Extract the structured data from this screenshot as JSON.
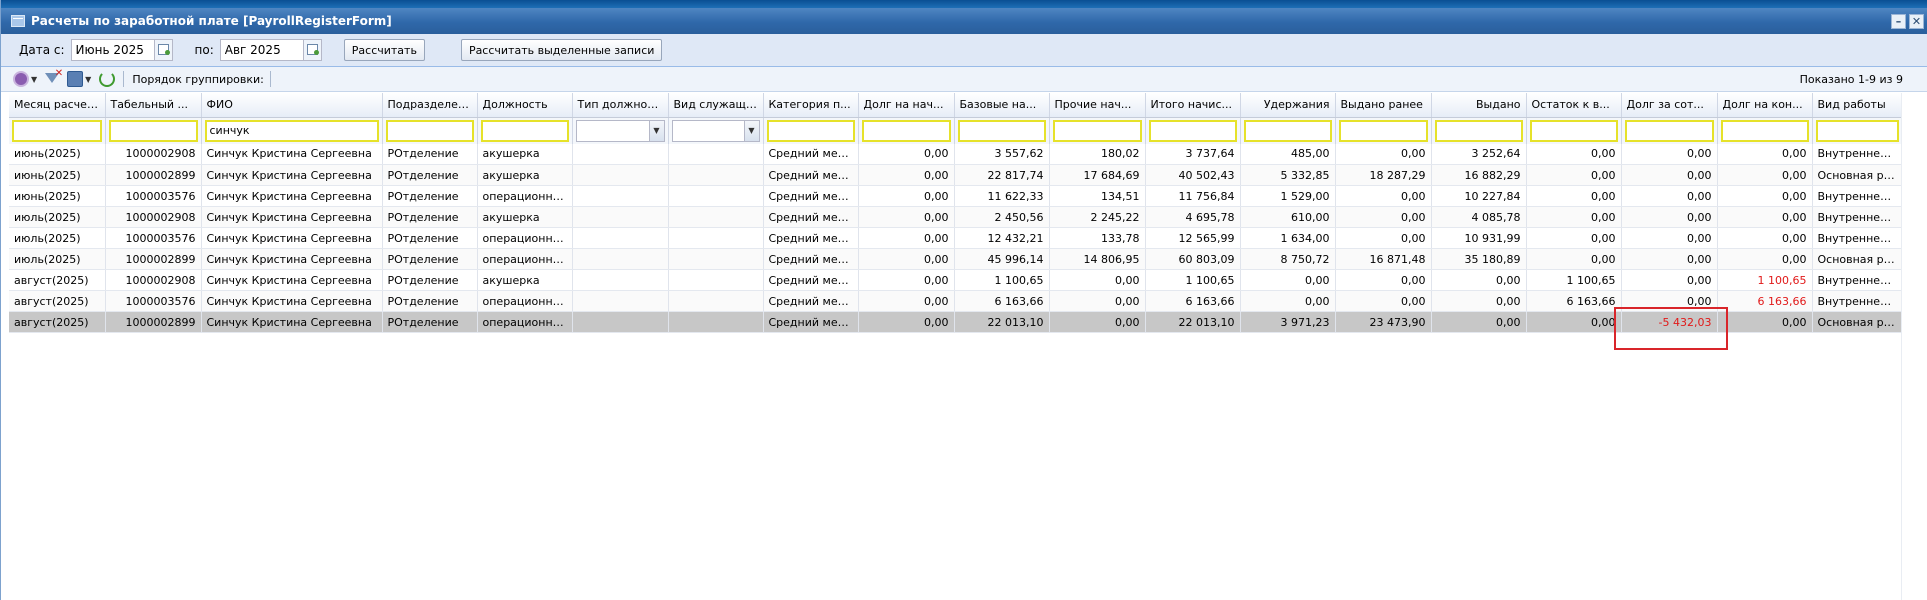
{
  "window": {
    "title": "Расчеты по заработной плате [PayrollRegisterForm]",
    "minimize_icon": "minimize-icon",
    "close_icon": "close-icon"
  },
  "datebar": {
    "from_label": "Дата с:",
    "from_value": "Июнь 2025",
    "to_label": "по:",
    "to_value": "Авг 2025",
    "calc_button": "Рассчитать",
    "calc_selected_button": "Рассчитать выделенные записи"
  },
  "toolbar": {
    "grouping_label": "Порядок группировки:",
    "shown_text": "Показано 1-9 из 9"
  },
  "columns": [
    {
      "label": "Месяц расчета",
      "align": "left"
    },
    {
      "label": "Табельный ...",
      "align": "left"
    },
    {
      "label": "ФИО",
      "align": "left"
    },
    {
      "label": "Подразделение",
      "align": "left"
    },
    {
      "label": "Должность",
      "align": "left"
    },
    {
      "label": "Тип должности",
      "align": "left"
    },
    {
      "label": "Вид служащего",
      "align": "left"
    },
    {
      "label": "Категория п...",
      "align": "left"
    },
    {
      "label": "Долг на нач...",
      "align": "left"
    },
    {
      "label": "Базовые на...",
      "align": "left"
    },
    {
      "label": "Прочие нач...",
      "align": "left"
    },
    {
      "label": "Итого начис...",
      "align": "left"
    },
    {
      "label": "Удержания",
      "align": "right"
    },
    {
      "label": "Выдано ранее",
      "align": "left"
    },
    {
      "label": "Выдано",
      "align": "right"
    },
    {
      "label": "Остаток к в...",
      "align": "left"
    },
    {
      "label": "Долг за сот...",
      "align": "left"
    },
    {
      "label": "Долг на кон...",
      "align": "left"
    },
    {
      "label": "Вид работы",
      "align": "left"
    }
  ],
  "filters": {
    "fio": "синчук"
  },
  "rows": [
    [
      "июнь(2025)",
      "1000002908",
      "Синчук Кристина Сергеевна",
      "РОтделение",
      "акушерка",
      "",
      "",
      "Средний меди...",
      "0,00",
      "3 557,62",
      "180,02",
      "3 737,64",
      "485,00",
      "0,00",
      "3 252,64",
      "0,00",
      "0,00",
      "0,00",
      "Внутреннее со..."
    ],
    [
      "июнь(2025)",
      "1000002899",
      "Синчук Кристина Сергеевна",
      "РОтделение",
      "акушерка",
      "",
      "",
      "Средний меди...",
      "0,00",
      "22 817,74",
      "17 684,69",
      "40 502,43",
      "5 332,85",
      "18 287,29",
      "16 882,29",
      "0,00",
      "0,00",
      "0,00",
      "Основная рабо..."
    ],
    [
      "июнь(2025)",
      "1000003576",
      "Синчук Кристина Сергеевна",
      "РОтделение",
      "операционная ...",
      "",
      "",
      "Средний меди...",
      "0,00",
      "11 622,33",
      "134,51",
      "11 756,84",
      "1 529,00",
      "0,00",
      "10 227,84",
      "0,00",
      "0,00",
      "0,00",
      "Внутреннее со..."
    ],
    [
      "июль(2025)",
      "1000002908",
      "Синчук Кристина Сергеевна",
      "РОтделение",
      "акушерка",
      "",
      "",
      "Средний меди...",
      "0,00",
      "2 450,56",
      "2 245,22",
      "4 695,78",
      "610,00",
      "0,00",
      "4 085,78",
      "0,00",
      "0,00",
      "0,00",
      "Внутреннее со..."
    ],
    [
      "июль(2025)",
      "1000003576",
      "Синчук Кристина Сергеевна",
      "РОтделение",
      "операционная ...",
      "",
      "",
      "Средний меди...",
      "0,00",
      "12 432,21",
      "133,78",
      "12 565,99",
      "1 634,00",
      "0,00",
      "10 931,99",
      "0,00",
      "0,00",
      "0,00",
      "Внутреннее со..."
    ],
    [
      "июль(2025)",
      "1000002899",
      "Синчук Кристина Сергеевна",
      "РОтделение",
      "операционная ...",
      "",
      "",
      "Средний меди...",
      "0,00",
      "45 996,14",
      "14 806,95",
      "60 803,09",
      "8 750,72",
      "16 871,48",
      "35 180,89",
      "0,00",
      "0,00",
      "0,00",
      "Основная рабо..."
    ],
    [
      "август(2025)",
      "1000002908",
      "Синчук Кристина Сергеевна",
      "РОтделение",
      "акушерка",
      "",
      "",
      "Средний меди...",
      "0,00",
      "1 100,65",
      "0,00",
      "1 100,65",
      "0,00",
      "0,00",
      "0,00",
      "1 100,65",
      "0,00",
      "1 100,65",
      "Внутреннее со..."
    ],
    [
      "август(2025)",
      "1000003576",
      "Синчук Кристина Сергеевна",
      "РОтделение",
      "операционная ...",
      "",
      "",
      "Средний меди...",
      "0,00",
      "6 163,66",
      "0,00",
      "6 163,66",
      "0,00",
      "0,00",
      "0,00",
      "6 163,66",
      "0,00",
      "6 163,66",
      "Внутреннее со..."
    ],
    [
      "август(2025)",
      "1000002899",
      "Синчук Кристина Сергеевна",
      "РОтделение",
      "операционная ...",
      "",
      "",
      "Средний меди...",
      "0,00",
      "22 013,10",
      "0,00",
      "22 013,10",
      "3 971,23",
      "23 473,90",
      "0,00",
      "0,00",
      "-5 432,03",
      "0,00",
      "Основная рабо..."
    ]
  ],
  "red_cells": [
    [
      6,
      17
    ],
    [
      7,
      17
    ],
    [
      8,
      16
    ]
  ],
  "selected_row": 8,
  "colors": {
    "title_bar": "#2f68aa",
    "negative_value": "#e11919",
    "highlight_box": "#d9252a",
    "filter_border": "#e6e22a",
    "selected_row": "#c7c7c7"
  }
}
